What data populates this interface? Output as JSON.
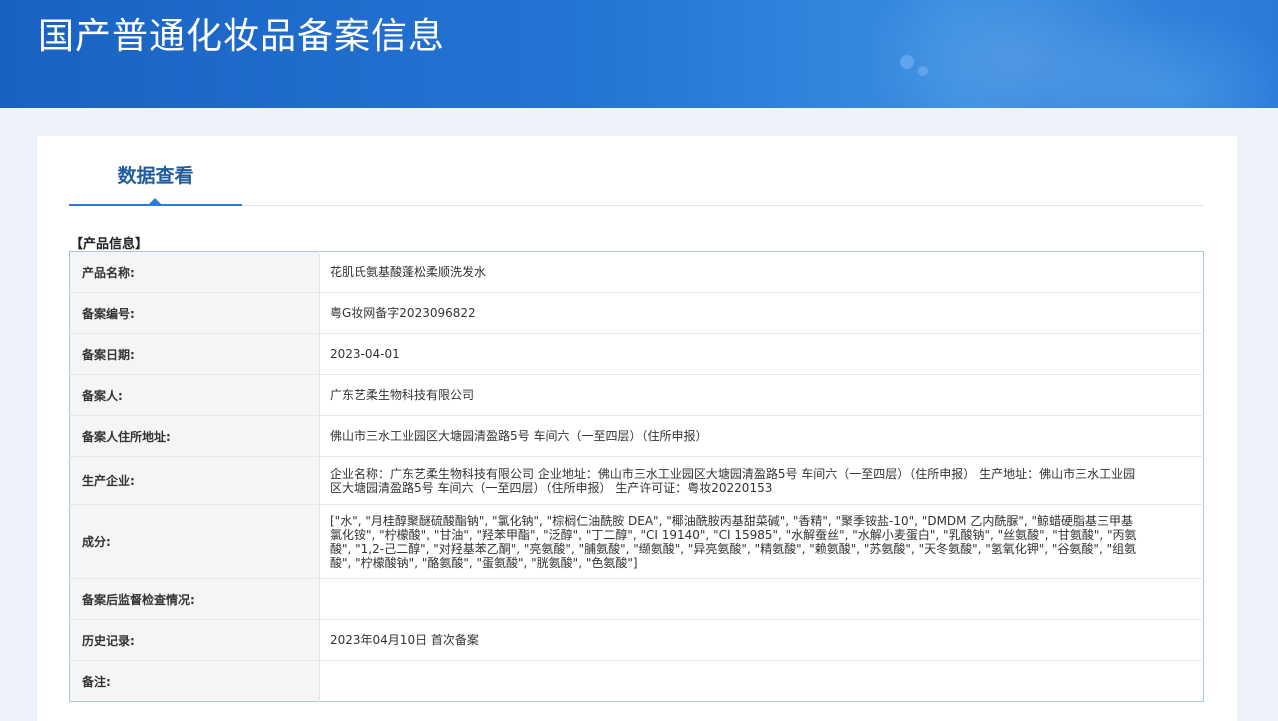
{
  "header": {
    "title": "国产普通化妆品备案信息"
  },
  "tabs": [
    {
      "label": "数据查看",
      "active": true
    }
  ],
  "section": {
    "title": "【产品信息】"
  },
  "rows": [
    {
      "label": "产品名称:",
      "value": "花肌氏氨基酸蓬松柔顺洗发水"
    },
    {
      "label": "备案编号:",
      "value": "粤G妆网备字2023096822"
    },
    {
      "label": "备案日期:",
      "value": "2023-04-01"
    },
    {
      "label": "备案人:",
      "value": "广东艺柔生物科技有限公司"
    },
    {
      "label": "备案人住所地址:",
      "value": "佛山市三水工业园区大塘园清盈路5号 车间六（一至四层）（住所申报）"
    },
    {
      "label": "生产企业:",
      "value": "企业名称：广东艺柔生物科技有限公司 企业地址：佛山市三水工业园区大塘园清盈路5号 车间六（一至四层）（住所申报） 生产地址：佛山市三水工业园区大塘园清盈路5号 车间六（一至四层）（住所申报） 生产许可证：粤妆20220153"
    },
    {
      "label": "成分:",
      "value": "[\"水\", \"月桂醇聚醚硫酸酯钠\", \"氯化钠\", \"棕榈仁油酰胺 DEA\", \"椰油酰胺丙基甜菜碱\", \"香精\", \"聚季铵盐-10\", \"DMDM 乙内酰脲\", \"鲸蜡硬脂基三甲基氯化铵\", \"柠檬酸\", \"甘油\", \"羟苯甲酯\", \"泛醇\", \"丁二醇\", \"CI 19140\", \"CI 15985\", \"水解蚕丝\", \"水解小麦蛋白\", \"乳酸钠\", \"丝氨酸\", \"甘氨酸\", \"丙氨酸\", \"1,2-己二醇\", \"对羟基苯乙酮\", \"亮氨酸\", \"脯氨酸\", \"缬氨酸\", \"异亮氨酸\", \"精氨酸\", \"赖氨酸\", \"苏氨酸\", \"天冬氨酸\", \"氢氧化钾\", \"谷氨酸\", \"组氨酸\", \"柠檬酸钠\", \"酪氨酸\", \"蛋氨酸\", \"胱氨酸\", \"色氨酸\"]"
    },
    {
      "label": "备案后监督检查情况:",
      "value": ""
    },
    {
      "label": "历史记录:",
      "value": "2023年04月10日 首次备案"
    },
    {
      "label": "备注:",
      "value": ""
    }
  ]
}
